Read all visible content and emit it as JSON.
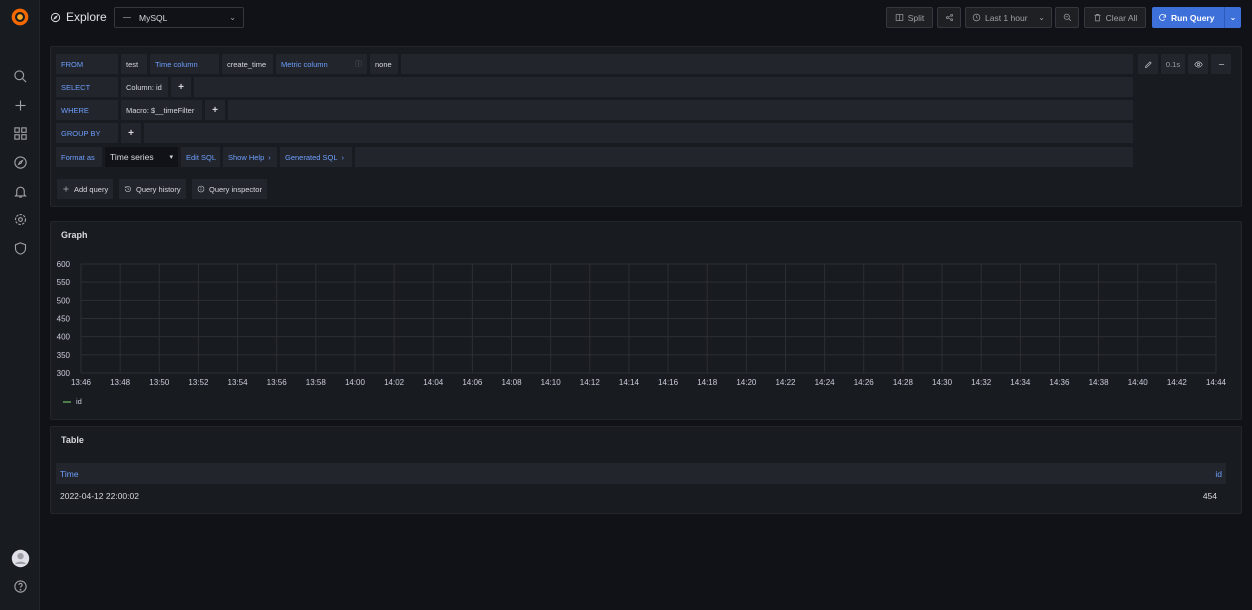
{
  "header": {
    "title": "Explore",
    "datasource": "MySQL",
    "split_label": "Split",
    "time_range": "Last 1 hour",
    "clear_label": "Clear All",
    "run_label": "Run Query"
  },
  "query": {
    "from_label": "FROM",
    "table": "test",
    "time_column_label": "Time column",
    "time_column_value": "create_time",
    "metric_column_label": "Metric column",
    "metric_column_value": "none",
    "select_label": "SELECT",
    "select_value": "Column: id",
    "where_label": "WHERE",
    "where_value": "Macro: $__timeFilter",
    "groupby_label": "GROUP BY",
    "format_label": "Format as",
    "format_value": "Time series",
    "edit_sql": "Edit SQL",
    "show_help": "Show Help",
    "generated_sql": "Generated SQL",
    "timing": "0.1s",
    "add_query": "Add query",
    "query_history": "Query history",
    "query_inspector": "Query inspector"
  },
  "graph": {
    "title": "Graph",
    "legend": "id"
  },
  "chart_data": {
    "type": "line",
    "x_ticks": [
      "13:46",
      "13:48",
      "13:50",
      "13:52",
      "13:54",
      "13:56",
      "13:58",
      "14:00",
      "14:02",
      "14:04",
      "14:06",
      "14:08",
      "14:10",
      "14:12",
      "14:14",
      "14:16",
      "14:18",
      "14:20",
      "14:22",
      "14:24",
      "14:26",
      "14:28",
      "14:30",
      "14:32",
      "14:34",
      "14:36",
      "14:38",
      "14:40",
      "14:42",
      "14:44"
    ],
    "y_ticks": [
      600,
      550,
      500,
      450,
      400,
      350,
      300
    ],
    "ylim": [
      300,
      600
    ],
    "series": [
      {
        "name": "id",
        "values": []
      }
    ],
    "grid": true,
    "legend_position": "bottom-left"
  },
  "table": {
    "title": "Table",
    "columns": [
      "Time",
      "id"
    ],
    "rows": [
      [
        "2022-04-12 22:00:02",
        "454"
      ]
    ]
  }
}
